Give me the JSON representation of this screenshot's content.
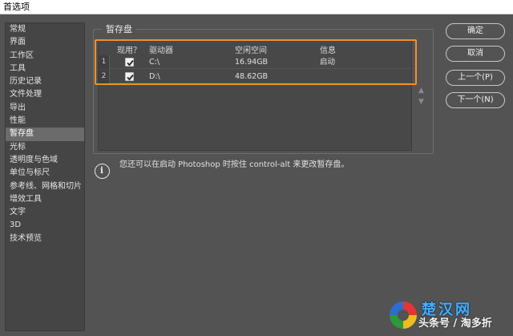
{
  "window": {
    "title": "首选项"
  },
  "sidebar": {
    "items": [
      {
        "label": "常规"
      },
      {
        "label": "界面"
      },
      {
        "label": "工作区"
      },
      {
        "label": "工具"
      },
      {
        "label": "历史记录"
      },
      {
        "label": "文件处理"
      },
      {
        "label": "导出"
      },
      {
        "label": "性能"
      },
      {
        "label": "暂存盘",
        "selected": true
      },
      {
        "label": "光标"
      },
      {
        "label": "透明度与色域"
      },
      {
        "label": "单位与标尺"
      },
      {
        "label": "参考线、网格和切片"
      },
      {
        "label": "增效工具"
      },
      {
        "label": "文字"
      },
      {
        "label": "3D"
      },
      {
        "label": "技术预览"
      }
    ]
  },
  "scratch": {
    "title": "暂存盘",
    "headers": {
      "active": "现用？",
      "drive": "驱动器",
      "free": "空闲空间",
      "info": "信息"
    },
    "rows": [
      {
        "num": "1",
        "checked": true,
        "drive": "C:\\",
        "free": "16.94GB",
        "info": "启动"
      },
      {
        "num": "2",
        "checked": true,
        "drive": "D:\\",
        "free": "48.62GB",
        "info": ""
      }
    ],
    "note": "您还可以在启动 Photoshop 时按住 control-alt 来更改暂存盘。"
  },
  "buttons": {
    "ok": "确定",
    "cancel": "取消",
    "prev": "上一个(P)",
    "next": "下一个(N)"
  },
  "watermark": {
    "brand": "楚汉网",
    "caption": "头条号 / 淘多折"
  },
  "colors": {
    "highlight": "#f0902a",
    "background": "#535353",
    "selected": "#6b6b6b"
  }
}
